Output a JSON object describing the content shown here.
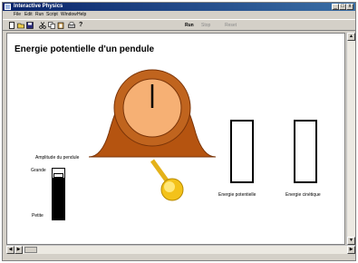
{
  "window": {
    "title": "Interactive Physics",
    "minimize": "_",
    "maximize": "□",
    "close": "x"
  },
  "menu": [
    "File",
    "Edit",
    "Run",
    "Script",
    "Window",
    "Help"
  ],
  "toolbar": {
    "run_label": "Run",
    "stop_label": "Stop",
    "reset_label": "Reset"
  },
  "canvas": {
    "title": "Energie potentielle d'un pendule",
    "amplitude": {
      "title": "Amplitude du pendule",
      "high_label": "Grande",
      "low_label": "Petite",
      "level": 0.82
    },
    "potential_energy": {
      "label": "Energie potentielle",
      "level": 0
    },
    "kinetic_energy": {
      "label": "Energie cinétique",
      "level": 0
    }
  },
  "colors": {
    "clock_body": "#b55410",
    "clock_face": "#f6b074",
    "bob": "#f3c21a",
    "rod": "#e4b21a"
  },
  "icons": {
    "toolbar": [
      "new-icon",
      "open-icon",
      "save-icon",
      "cut-icon",
      "copy-icon",
      "paste-icon",
      "print-icon",
      "help-icon"
    ]
  }
}
